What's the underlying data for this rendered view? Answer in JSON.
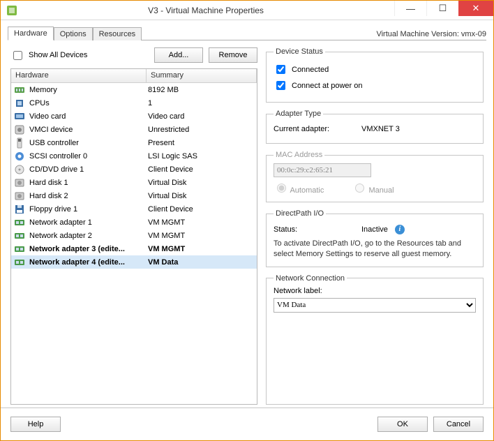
{
  "window": {
    "title": "V3 - Virtual Machine Properties",
    "minimize": "—",
    "maximize": "☐",
    "close": "✕"
  },
  "version_label": "Virtual Machine Version: vmx-09",
  "tabs": {
    "hardware": "Hardware",
    "options": "Options",
    "resources": "Resources"
  },
  "controls": {
    "show_all": "Show All Devices",
    "add": "Add...",
    "remove": "Remove"
  },
  "columns": {
    "hardware": "Hardware",
    "summary": "Summary"
  },
  "hardware": [
    {
      "icon": "memory-icon",
      "name": "Memory",
      "summary": "8192 MB"
    },
    {
      "icon": "cpu-icon",
      "name": "CPUs",
      "summary": "1"
    },
    {
      "icon": "video-icon",
      "name": "Video card",
      "summary": "Video card"
    },
    {
      "icon": "vmci-icon",
      "name": "VMCI device",
      "summary": "Unrestricted"
    },
    {
      "icon": "usb-icon",
      "name": "USB controller",
      "summary": "Present"
    },
    {
      "icon": "scsi-icon",
      "name": "SCSI controller 0",
      "summary": "LSI Logic SAS"
    },
    {
      "icon": "cddvd-icon",
      "name": "CD/DVD drive 1",
      "summary": "Client Device"
    },
    {
      "icon": "disk-icon",
      "name": "Hard disk 1",
      "summary": "Virtual Disk"
    },
    {
      "icon": "disk-icon",
      "name": "Hard disk 2",
      "summary": "Virtual Disk"
    },
    {
      "icon": "floppy-icon",
      "name": "Floppy drive 1",
      "summary": "Client Device"
    },
    {
      "icon": "nic-icon",
      "name": "Network adapter 1",
      "summary": "VM MGMT"
    },
    {
      "icon": "nic-icon",
      "name": "Network adapter 2",
      "summary": "VM MGMT"
    },
    {
      "icon": "nic-icon",
      "name": "Network adapter 3 (edite...",
      "summary": "VM MGMT",
      "bold": true
    },
    {
      "icon": "nic-icon",
      "name": "Network adapter 4 (edite...",
      "summary": "VM Data",
      "bold": true,
      "selected": true
    }
  ],
  "device_status": {
    "legend": "Device Status",
    "connected": "Connected",
    "connect_power_on": "Connect at power on",
    "connected_checked": true,
    "power_on_checked": true
  },
  "adapter_type": {
    "legend": "Adapter Type",
    "label": "Current adapter:",
    "value": "VMXNET 3"
  },
  "mac": {
    "legend": "MAC Address",
    "value": "00:0c:29:c2:65:21",
    "automatic": "Automatic",
    "manual": "Manual"
  },
  "directpath": {
    "legend": "DirectPath I/O",
    "status_label": "Status:",
    "status_value": "Inactive",
    "note": "To activate DirectPath I/O, go to the Resources tab and select Memory Settings to reserve all guest memory."
  },
  "network_connection": {
    "legend": "Network Connection",
    "label": "Network label:",
    "value": "VM Data"
  },
  "footer": {
    "help": "Help",
    "ok": "OK",
    "cancel": "Cancel"
  }
}
